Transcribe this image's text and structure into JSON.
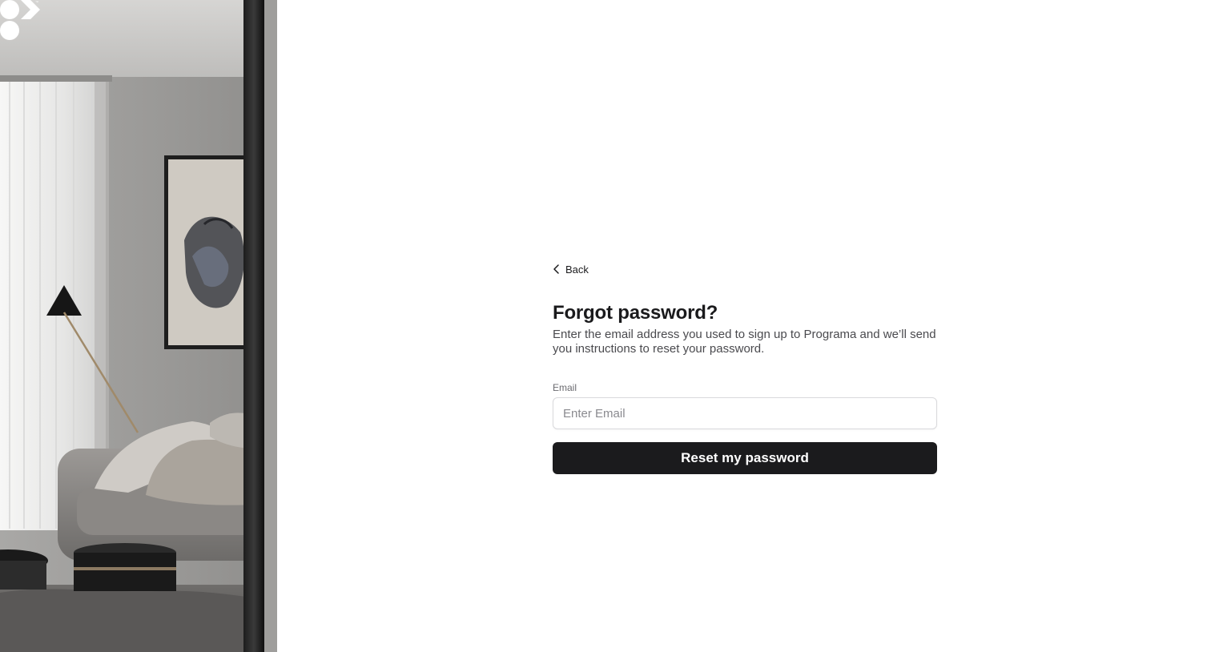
{
  "brand": {
    "logo_icon": "programa-logo-icon",
    "accent": "#1b1b1d"
  },
  "nav": {
    "back_label": "Back",
    "back_icon": "chevron-left-icon"
  },
  "form": {
    "title": "Forgot password?",
    "description": "Enter the email address you used to sign up to Programa and we’ll send you instructions to reset your password.",
    "email_label": "Email",
    "email_placeholder": "Enter Email",
    "email_value": "",
    "submit_label": "Reset my password"
  }
}
